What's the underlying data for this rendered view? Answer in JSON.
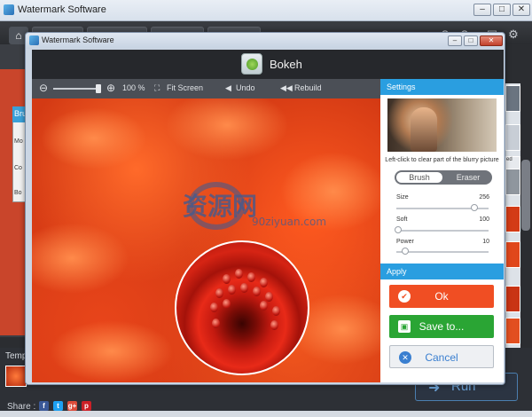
{
  "outer_window": {
    "title": "Watermark Software",
    "minimize": "–",
    "maximize": "□",
    "close": "✕",
    "left_panel": {
      "header": "Brus",
      "rows": [
        "Mo",
        "Co",
        "Bo"
      ]
    },
    "right_thumb_label": "ed",
    "bottom": {
      "templates_label": "Temp",
      "share_label": "Share :",
      "social_icons": [
        "facebook-icon",
        "twitter-icon",
        "google-plus-icon",
        "pinterest-icon"
      ],
      "social_glyphs": [
        "f",
        "t",
        "g+",
        "p"
      ],
      "run_label": "Run"
    }
  },
  "dialog": {
    "title": "Watermark Software",
    "header_title": "Bokeh",
    "toolbar": {
      "zoom_out": "⊖",
      "zoom_in": "⊕",
      "zoom_value": "100 %",
      "fit_screen": "Fit Screen",
      "undo": "Undo",
      "rebuild": "Rebuild",
      "zoom_level": 0.95
    },
    "watermark": {
      "text": "资源网",
      "sub": "90ziyuan.com"
    },
    "settings": {
      "header": "Settings",
      "hint": "Left-click to clear part of the blurry picture",
      "toggle": {
        "brush": "Brush",
        "eraser": "Eraser",
        "selected": "brush"
      },
      "sliders": [
        {
          "label": "Size",
          "value": "256",
          "level": 0.86
        },
        {
          "label": "Soft",
          "value": "100",
          "level": 0.0
        },
        {
          "label": "Power",
          "value": "10",
          "level": 0.08
        }
      ]
    },
    "apply": {
      "header": "Apply",
      "ok": "Ok",
      "save": "Save to...",
      "cancel": "Cancel"
    },
    "colors": {
      "ok": "#f04e23",
      "save": "#2aa534",
      "cancel_bg": "#eef0f3",
      "cancel_text": "#3a7fd0",
      "panel_head": "#2a9ee0"
    }
  }
}
